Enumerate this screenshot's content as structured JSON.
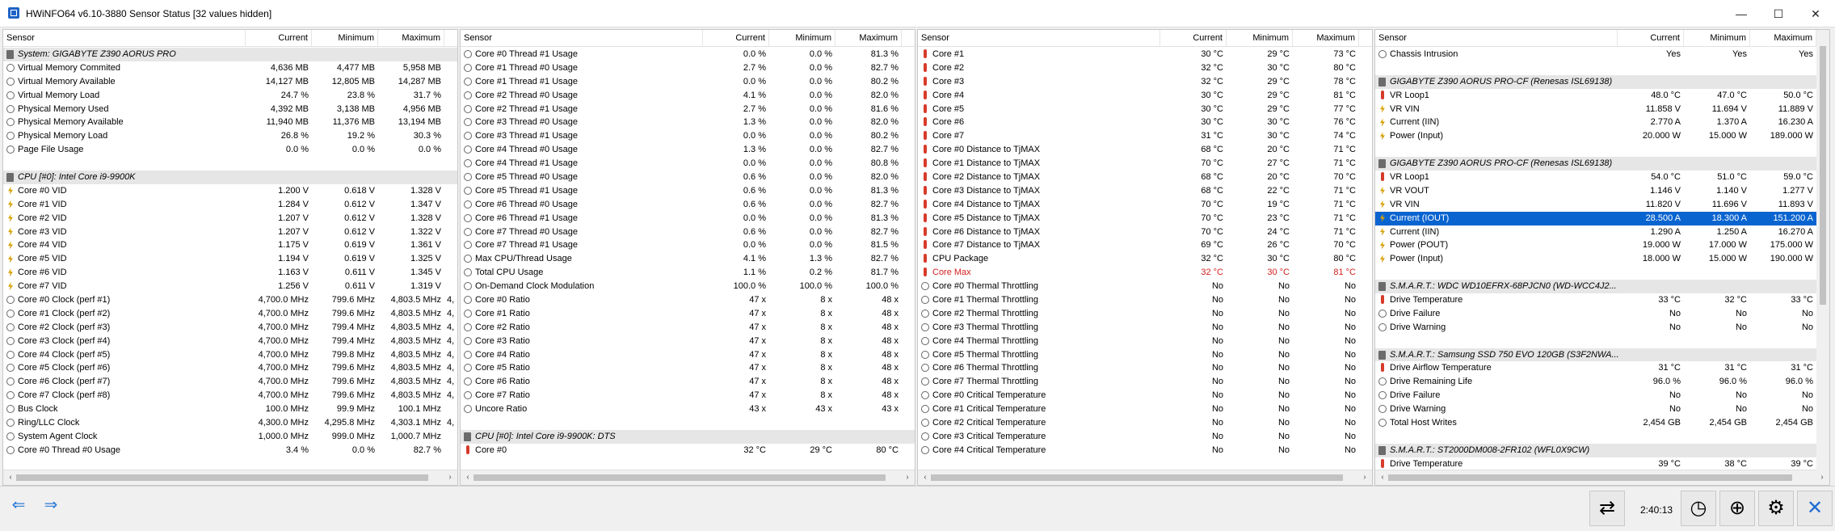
{
  "window": {
    "title": "HWiNFO64 v6.10-3880 Sensor Status [32 values hidden]",
    "minimize": "—",
    "maximize": "☐",
    "close": "✕"
  },
  "columns": [
    "Sensor",
    "Current",
    "Minimum",
    "Maximum"
  ],
  "panels": [
    {
      "rows": [
        {
          "t": "chip",
          "g": 1,
          "n": "System: GIGABYTE Z390 AORUS PRO"
        },
        {
          "t": "clock",
          "n": "Virtual Memory Commited",
          "c": "4,636 MB",
          "mi": "4,477 MB",
          "ma": "5,958 MB"
        },
        {
          "t": "clock",
          "n": "Virtual Memory Available",
          "c": "14,127 MB",
          "mi": "12,805 MB",
          "ma": "14,287 MB"
        },
        {
          "t": "clock",
          "n": "Virtual Memory Load",
          "c": "24.7 %",
          "mi": "23.8 %",
          "ma": "31.7 %"
        },
        {
          "t": "clock",
          "n": "Physical Memory Used",
          "c": "4,392 MB",
          "mi": "3,138 MB",
          "ma": "4,956 MB"
        },
        {
          "t": "clock",
          "n": "Physical Memory Available",
          "c": "11,940 MB",
          "mi": "11,376 MB",
          "ma": "13,194 MB"
        },
        {
          "t": "clock",
          "n": "Physical Memory Load",
          "c": "26.8 %",
          "mi": "19.2 %",
          "ma": "30.3 %"
        },
        {
          "t": "clock",
          "n": "Page File Usage",
          "c": "0.0 %",
          "mi": "0.0 %",
          "ma": "0.0 %"
        },
        {
          "t": "none",
          "n": ""
        },
        {
          "t": "chip",
          "g": 1,
          "n": "CPU [#0]: Intel Core i9-9900K"
        },
        {
          "t": "volt",
          "n": "Core #0 VID",
          "c": "1.200 V",
          "mi": "0.618 V",
          "ma": "1.328 V"
        },
        {
          "t": "volt",
          "n": "Core #1 VID",
          "c": "1.284 V",
          "mi": "0.612 V",
          "ma": "1.347 V"
        },
        {
          "t": "volt",
          "n": "Core #2 VID",
          "c": "1.207 V",
          "mi": "0.612 V",
          "ma": "1.328 V"
        },
        {
          "t": "volt",
          "n": "Core #3 VID",
          "c": "1.207 V",
          "mi": "0.612 V",
          "ma": "1.322 V"
        },
        {
          "t": "volt",
          "n": "Core #4 VID",
          "c": "1.175 V",
          "mi": "0.619 V",
          "ma": "1.361 V"
        },
        {
          "t": "volt",
          "n": "Core #5 VID",
          "c": "1.194 V",
          "mi": "0.619 V",
          "ma": "1.325 V"
        },
        {
          "t": "volt",
          "n": "Core #6 VID",
          "c": "1.163 V",
          "mi": "0.611 V",
          "ma": "1.345 V"
        },
        {
          "t": "volt",
          "n": "Core #7 VID",
          "c": "1.256 V",
          "mi": "0.611 V",
          "ma": "1.319 V"
        },
        {
          "t": "clock",
          "n": "Core #0 Clock (perf #1)",
          "c": "4,700.0 MHz",
          "mi": "799.6 MHz",
          "ma": "4,803.5 MHz",
          "x": "4,"
        },
        {
          "t": "clock",
          "n": "Core #1 Clock (perf #2)",
          "c": "4,700.0 MHz",
          "mi": "799.6 MHz",
          "ma": "4,803.5 MHz",
          "x": "4,"
        },
        {
          "t": "clock",
          "n": "Core #2 Clock (perf #3)",
          "c": "4,700.0 MHz",
          "mi": "799.4 MHz",
          "ma": "4,803.5 MHz",
          "x": "4,"
        },
        {
          "t": "clock",
          "n": "Core #3 Clock (perf #4)",
          "c": "4,700.0 MHz",
          "mi": "799.4 MHz",
          "ma": "4,803.5 MHz",
          "x": "4,"
        },
        {
          "t": "clock",
          "n": "Core #4 Clock (perf #5)",
          "c": "4,700.0 MHz",
          "mi": "799.8 MHz",
          "ma": "4,803.5 MHz",
          "x": "4,"
        },
        {
          "t": "clock",
          "n": "Core #5 Clock (perf #6)",
          "c": "4,700.0 MHz",
          "mi": "799.6 MHz",
          "ma": "4,803.5 MHz",
          "x": "4,"
        },
        {
          "t": "clock",
          "n": "Core #6 Clock (perf #7)",
          "c": "4,700.0 MHz",
          "mi": "799.6 MHz",
          "ma": "4,803.5 MHz",
          "x": "4,"
        },
        {
          "t": "clock",
          "n": "Core #7 Clock (perf #8)",
          "c": "4,700.0 MHz",
          "mi": "799.6 MHz",
          "ma": "4,803.5 MHz",
          "x": "4,"
        },
        {
          "t": "clock",
          "n": "Bus Clock",
          "c": "100.0 MHz",
          "mi": "99.9 MHz",
          "ma": "100.1 MHz"
        },
        {
          "t": "clock",
          "n": "Ring/LLC Clock",
          "c": "4,300.0 MHz",
          "mi": "4,295.8 MHz",
          "ma": "4,303.1 MHz",
          "x": "4,"
        },
        {
          "t": "clock",
          "n": "System Agent Clock",
          "c": "1,000.0 MHz",
          "mi": "999.0 MHz",
          "ma": "1,000.7 MHz"
        },
        {
          "t": "clock",
          "n": "Core #0 Thread #0 Usage",
          "c": "3.4 %",
          "mi": "0.0 %",
          "ma": "82.7 %"
        }
      ]
    },
    {
      "rows": [
        {
          "t": "clock",
          "n": "Core #0 Thread #1 Usage",
          "c": "0.0 %",
          "mi": "0.0 %",
          "ma": "81.3 %"
        },
        {
          "t": "clock",
          "n": "Core #1 Thread #0 Usage",
          "c": "2.7 %",
          "mi": "0.0 %",
          "ma": "82.7 %"
        },
        {
          "t": "clock",
          "n": "Core #1 Thread #1 Usage",
          "c": "0.0 %",
          "mi": "0.0 %",
          "ma": "80.2 %"
        },
        {
          "t": "clock",
          "n": "Core #2 Thread #0 Usage",
          "c": "4.1 %",
          "mi": "0.0 %",
          "ma": "82.0 %"
        },
        {
          "t": "clock",
          "n": "Core #2 Thread #1 Usage",
          "c": "2.7 %",
          "mi": "0.0 %",
          "ma": "81.6 %"
        },
        {
          "t": "clock",
          "n": "Core #3 Thread #0 Usage",
          "c": "1.3 %",
          "mi": "0.0 %",
          "ma": "82.0 %"
        },
        {
          "t": "clock",
          "n": "Core #3 Thread #1 Usage",
          "c": "0.0 %",
          "mi": "0.0 %",
          "ma": "80.2 %"
        },
        {
          "t": "clock",
          "n": "Core #4 Thread #0 Usage",
          "c": "1.3 %",
          "mi": "0.0 %",
          "ma": "82.7 %"
        },
        {
          "t": "clock",
          "n": "Core #4 Thread #1 Usage",
          "c": "0.0 %",
          "mi": "0.0 %",
          "ma": "80.8 %"
        },
        {
          "t": "clock",
          "n": "Core #5 Thread #0 Usage",
          "c": "0.6 %",
          "mi": "0.0 %",
          "ma": "82.0 %"
        },
        {
          "t": "clock",
          "n": "Core #5 Thread #1 Usage",
          "c": "0.6 %",
          "mi": "0.0 %",
          "ma": "81.3 %"
        },
        {
          "t": "clock",
          "n": "Core #6 Thread #0 Usage",
          "c": "0.6 %",
          "mi": "0.0 %",
          "ma": "82.7 %"
        },
        {
          "t": "clock",
          "n": "Core #6 Thread #1 Usage",
          "c": "0.0 %",
          "mi": "0.0 %",
          "ma": "81.3 %"
        },
        {
          "t": "clock",
          "n": "Core #7 Thread #0 Usage",
          "c": "0.6 %",
          "mi": "0.0 %",
          "ma": "82.7 %"
        },
        {
          "t": "clock",
          "n": "Core #7 Thread #1 Usage",
          "c": "0.0 %",
          "mi": "0.0 %",
          "ma": "81.5 %"
        },
        {
          "t": "clock",
          "n": "Max CPU/Thread Usage",
          "c": "4.1 %",
          "mi": "1.3 %",
          "ma": "82.7 %"
        },
        {
          "t": "clock",
          "n": "Total CPU Usage",
          "c": "1.1 %",
          "mi": "0.2 %",
          "ma": "81.7 %"
        },
        {
          "t": "clock",
          "n": "On-Demand Clock Modulation",
          "c": "100.0 %",
          "mi": "100.0 %",
          "ma": "100.0 %"
        },
        {
          "t": "clock",
          "n": "Core #0 Ratio",
          "c": "47 x",
          "mi": "8 x",
          "ma": "48 x"
        },
        {
          "t": "clock",
          "n": "Core #1 Ratio",
          "c": "47 x",
          "mi": "8 x",
          "ma": "48 x"
        },
        {
          "t": "clock",
          "n": "Core #2 Ratio",
          "c": "47 x",
          "mi": "8 x",
          "ma": "48 x"
        },
        {
          "t": "clock",
          "n": "Core #3 Ratio",
          "c": "47 x",
          "mi": "8 x",
          "ma": "48 x"
        },
        {
          "t": "clock",
          "n": "Core #4 Ratio",
          "c": "47 x",
          "mi": "8 x",
          "ma": "48 x"
        },
        {
          "t": "clock",
          "n": "Core #5 Ratio",
          "c": "47 x",
          "mi": "8 x",
          "ma": "48 x"
        },
        {
          "t": "clock",
          "n": "Core #6 Ratio",
          "c": "47 x",
          "mi": "8 x",
          "ma": "48 x"
        },
        {
          "t": "clock",
          "n": "Core #7 Ratio",
          "c": "47 x",
          "mi": "8 x",
          "ma": "48 x"
        },
        {
          "t": "clock",
          "n": "Uncore Ratio",
          "c": "43 x",
          "mi": "43 x",
          "ma": "43 x"
        },
        {
          "t": "none",
          "n": ""
        },
        {
          "t": "chip",
          "g": 1,
          "n": "CPU [#0]: Intel Core i9-9900K: DTS"
        },
        {
          "t": "temp",
          "n": "Core #0",
          "c": "32 °C",
          "mi": "29 °C",
          "ma": "80 °C"
        }
      ]
    },
    {
      "rows": [
        {
          "t": "temp",
          "n": "Core #1",
          "c": "30 °C",
          "mi": "29 °C",
          "ma": "73 °C"
        },
        {
          "t": "temp",
          "n": "Core #2",
          "c": "32 °C",
          "mi": "30 °C",
          "ma": "80 °C"
        },
        {
          "t": "temp",
          "n": "Core #3",
          "c": "32 °C",
          "mi": "29 °C",
          "ma": "78 °C"
        },
        {
          "t": "temp",
          "n": "Core #4",
          "c": "30 °C",
          "mi": "29 °C",
          "ma": "81 °C"
        },
        {
          "t": "temp",
          "n": "Core #5",
          "c": "30 °C",
          "mi": "29 °C",
          "ma": "77 °C"
        },
        {
          "t": "temp",
          "n": "Core #6",
          "c": "30 °C",
          "mi": "30 °C",
          "ma": "76 °C"
        },
        {
          "t": "temp",
          "n": "Core #7",
          "c": "31 °C",
          "mi": "30 °C",
          "ma": "74 °C"
        },
        {
          "t": "temp",
          "n": "Core #0 Distance to TjMAX",
          "c": "68 °C",
          "mi": "20 °C",
          "ma": "71 °C"
        },
        {
          "t": "temp",
          "n": "Core #1 Distance to TjMAX",
          "c": "70 °C",
          "mi": "27 °C",
          "ma": "71 °C"
        },
        {
          "t": "temp",
          "n": "Core #2 Distance to TjMAX",
          "c": "68 °C",
          "mi": "20 °C",
          "ma": "70 °C"
        },
        {
          "t": "temp",
          "n": "Core #3 Distance to TjMAX",
          "c": "68 °C",
          "mi": "22 °C",
          "ma": "71 °C"
        },
        {
          "t": "temp",
          "n": "Core #4 Distance to TjMAX",
          "c": "70 °C",
          "mi": "19 °C",
          "ma": "71 °C"
        },
        {
          "t": "temp",
          "n": "Core #5 Distance to TjMAX",
          "c": "70 °C",
          "mi": "23 °C",
          "ma": "71 °C"
        },
        {
          "t": "temp",
          "n": "Core #6 Distance to TjMAX",
          "c": "70 °C",
          "mi": "24 °C",
          "ma": "71 °C"
        },
        {
          "t": "temp",
          "n": "Core #7 Distance to TjMAX",
          "c": "69 °C",
          "mi": "26 °C",
          "ma": "70 °C"
        },
        {
          "t": "temp",
          "n": "CPU Package",
          "c": "32 °C",
          "mi": "30 °C",
          "ma": "80 °C"
        },
        {
          "t": "temp",
          "red": 1,
          "n": "Core Max",
          "c": "32 °C",
          "mi": "30 °C",
          "ma": "81 °C"
        },
        {
          "t": "clock",
          "n": "Core #0 Thermal Throttling",
          "c": "No",
          "mi": "No",
          "ma": "No"
        },
        {
          "t": "clock",
          "n": "Core #1 Thermal Throttling",
          "c": "No",
          "mi": "No",
          "ma": "No"
        },
        {
          "t": "clock",
          "n": "Core #2 Thermal Throttling",
          "c": "No",
          "mi": "No",
          "ma": "No"
        },
        {
          "t": "clock",
          "n": "Core #3 Thermal Throttling",
          "c": "No",
          "mi": "No",
          "ma": "No"
        },
        {
          "t": "clock",
          "n": "Core #4 Thermal Throttling",
          "c": "No",
          "mi": "No",
          "ma": "No"
        },
        {
          "t": "clock",
          "n": "Core #5 Thermal Throttling",
          "c": "No",
          "mi": "No",
          "ma": "No"
        },
        {
          "t": "clock",
          "n": "Core #6 Thermal Throttling",
          "c": "No",
          "mi": "No",
          "ma": "No"
        },
        {
          "t": "clock",
          "n": "Core #7 Thermal Throttling",
          "c": "No",
          "mi": "No",
          "ma": "No"
        },
        {
          "t": "clock",
          "n": "Core #0 Critical Temperature",
          "c": "No",
          "mi": "No",
          "ma": "No"
        },
        {
          "t": "clock",
          "n": "Core #1 Critical Temperature",
          "c": "No",
          "mi": "No",
          "ma": "No"
        },
        {
          "t": "clock",
          "n": "Core #2 Critical Temperature",
          "c": "No",
          "mi": "No",
          "ma": "No"
        },
        {
          "t": "clock",
          "n": "Core #3 Critical Temperature",
          "c": "No",
          "mi": "No",
          "ma": "No"
        },
        {
          "t": "clock",
          "n": "Core #4 Critical Temperature",
          "c": "No",
          "mi": "No",
          "ma": "No"
        }
      ]
    },
    {
      "rows": [
        {
          "t": "intr",
          "n": "Chassis Intrusion",
          "c": "Yes",
          "mi": "Yes",
          "ma": "Yes"
        },
        {
          "t": "none",
          "n": ""
        },
        {
          "t": "chip",
          "g": 1,
          "n": "GIGABYTE Z390 AORUS PRO-CF (Renesas ISL69138)"
        },
        {
          "t": "temp",
          "n": "VR Loop1",
          "c": "48.0 °C",
          "mi": "47.0 °C",
          "ma": "50.0 °C"
        },
        {
          "t": "volt",
          "n": "VR VIN",
          "c": "11.858 V",
          "mi": "11.694 V",
          "ma": "11.889 V"
        },
        {
          "t": "volt",
          "n": "Current (IIN)",
          "c": "2.770 A",
          "mi": "1.370 A",
          "ma": "16.230 A"
        },
        {
          "t": "volt",
          "n": "Power (Input)",
          "c": "20.000 W",
          "mi": "15.000 W",
          "ma": "189.000 W"
        },
        {
          "t": "none",
          "n": ""
        },
        {
          "t": "chip",
          "g": 1,
          "n": "GIGABYTE Z390 AORUS PRO-CF (Renesas ISL69138)"
        },
        {
          "t": "temp",
          "n": "VR Loop1",
          "c": "54.0 °C",
          "mi": "51.0 °C",
          "ma": "59.0 °C"
        },
        {
          "t": "volt",
          "n": "VR VOUT",
          "c": "1.146 V",
          "mi": "1.140 V",
          "ma": "1.277 V"
        },
        {
          "t": "volt",
          "n": "VR VIN",
          "c": "11.820 V",
          "mi": "11.696 V",
          "ma": "11.893 V"
        },
        {
          "t": "volt",
          "sel": 1,
          "n": "Current (IOUT)",
          "c": "28.500 A",
          "mi": "18.300 A",
          "ma": "151.200 A"
        },
        {
          "t": "volt",
          "n": "Current (IIN)",
          "c": "1.290 A",
          "mi": "1.250 A",
          "ma": "16.270 A"
        },
        {
          "t": "volt",
          "n": "Power (POUT)",
          "c": "19.000 W",
          "mi": "17.000 W",
          "ma": "175.000 W"
        },
        {
          "t": "volt",
          "n": "Power (Input)",
          "c": "18.000 W",
          "mi": "15.000 W",
          "ma": "190.000 W"
        },
        {
          "t": "none",
          "n": ""
        },
        {
          "t": "chip",
          "g": 1,
          "n": "S.M.A.R.T.: WDC WD10EFRX-68PJCN0 (WD-WCC4J2..."
        },
        {
          "t": "temp",
          "n": "Drive Temperature",
          "c": "33 °C",
          "mi": "32 °C",
          "ma": "33 °C"
        },
        {
          "t": "clock",
          "n": "Drive Failure",
          "c": "No",
          "mi": "No",
          "ma": "No"
        },
        {
          "t": "clock",
          "n": "Drive Warning",
          "c": "No",
          "mi": "No",
          "ma": "No"
        },
        {
          "t": "none",
          "n": ""
        },
        {
          "t": "chip",
          "g": 1,
          "n": "S.M.A.R.T.: Samsung SSD 750 EVO 120GB (S3F2NWA..."
        },
        {
          "t": "temp",
          "n": "Drive Airflow Temperature",
          "c": "31 °C",
          "mi": "31 °C",
          "ma": "31 °C"
        },
        {
          "t": "clock",
          "n": "Drive Remaining Life",
          "c": "96.0 %",
          "mi": "96.0 %",
          "ma": "96.0 %"
        },
        {
          "t": "clock",
          "n": "Drive Failure",
          "c": "No",
          "mi": "No",
          "ma": "No"
        },
        {
          "t": "clock",
          "n": "Drive Warning",
          "c": "No",
          "mi": "No",
          "ma": "No"
        },
        {
          "t": "clock",
          "n": "Total Host Writes",
          "c": "2,454 GB",
          "mi": "2,454 GB",
          "ma": "2,454 GB"
        },
        {
          "t": "none",
          "n": ""
        },
        {
          "t": "chip",
          "g": 1,
          "n": "S.M.A.R.T.: ST2000DM008-2FR102 (WFL0X9CW)"
        },
        {
          "t": "temp",
          "n": "Drive Temperature",
          "c": "39 °C",
          "mi": "38 °C",
          "ma": "39 °C"
        }
      ]
    }
  ],
  "footer": {
    "timer": "2:40:13",
    "nav_back": "⇐",
    "nav_fwd": "⇒"
  }
}
